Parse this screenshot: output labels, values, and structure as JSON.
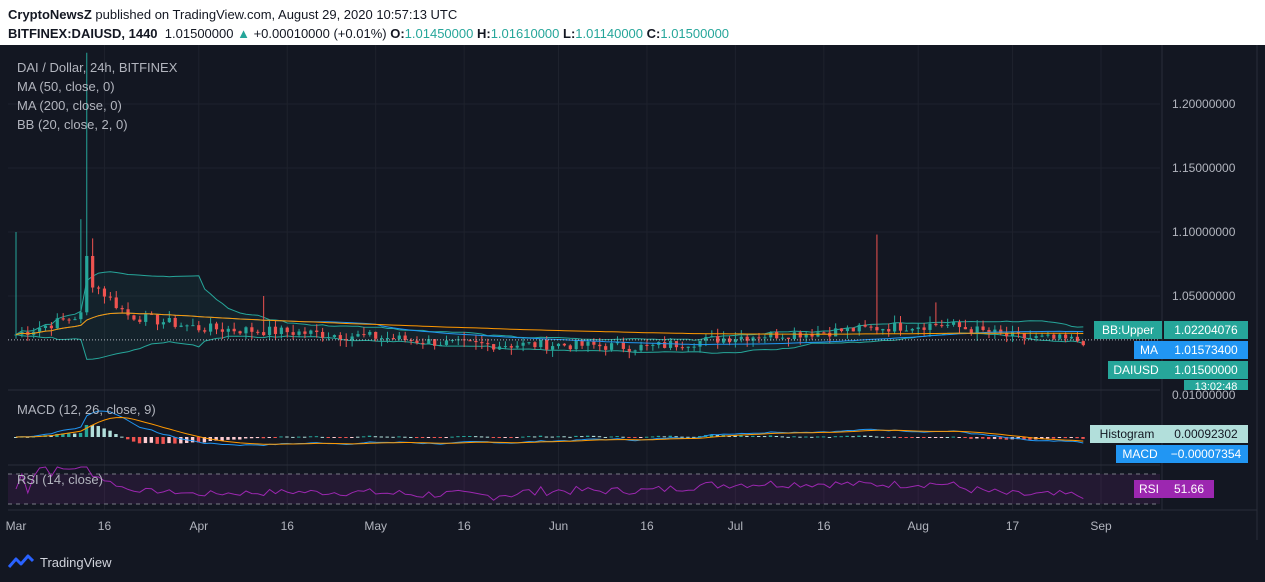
{
  "header": {
    "publisher": "CryptoNewsZ",
    "published_text": "published on TradingView.com, August 29, 2020 10:57:13 UTC",
    "symbol": "BITFINEX:DAIUSD, 1440",
    "last": "1.01500000",
    "change": "+0.00010000 (+0.01%)",
    "o_label": "O:",
    "o_value": "1.01450000",
    "h_label": "H:",
    "h_value": "1.01610000",
    "l_label": "L:",
    "l_value": "1.01140000",
    "c_label": "C:",
    "c_value": "1.01500000"
  },
  "legend": {
    "title": "DAI / Dollar, 24h, BITFINEX",
    "ma50": "MA (50, close, 0)",
    "ma200": "MA (200, close, 0)",
    "bb": "BB (20, close, 2, 0)",
    "macd": "MACD (12, 26, close, 9)",
    "rsi": "RSI (14, close)"
  },
  "price_axis": {
    "ticks": [
      "1.20000000",
      "1.15000000",
      "1.10000000",
      "1.05000000"
    ],
    "macd_tick": "0.01000000"
  },
  "price_labels": {
    "bb_upper_name": "BB:Upper",
    "bb_upper_value": "1.02204076",
    "ma_name": "MA",
    "ma_value": "1.01573400",
    "symbol_name": "DAIUSD",
    "symbol_value": "1.01500000",
    "countdown": "13:02:48",
    "histogram_name": "Histogram",
    "histogram_value": "0.00092302",
    "macd_name": "MACD",
    "macd_value": "−0.00007354",
    "rsi_name": "RSI",
    "rsi_value": "51.66"
  },
  "time_axis": {
    "labels": [
      "Mar",
      "16",
      "Apr",
      "16",
      "May",
      "16",
      "Jun",
      "16",
      "Jul",
      "16",
      "Aug",
      "17",
      "Sep"
    ]
  },
  "brand": {
    "name": "TradingView",
    "icon": "tradingview-logo-icon"
  },
  "colors": {
    "up": "#26a69a",
    "down": "#ef5350",
    "ma50": "#2196f3",
    "ma200": "#ff9800",
    "bb": "#26a69a",
    "macd": "#2196f3",
    "signal": "#ff9800",
    "rsi": "#9c27b0"
  },
  "chart_data": [
    {
      "type": "candlestick",
      "title": "DAI / Dollar, 24h, BITFINEX",
      "x_range": [
        "2020-03-01",
        "2020-08-29"
      ],
      "y_ticks": [
        1.05,
        1.1,
        1.15,
        1.2
      ],
      "series": [
        {
          "name": "DAIUSD",
          "last": 1.015,
          "open": 1.0145,
          "high": 1.0161,
          "low": 1.0114,
          "close": 1.015
        },
        {
          "name": "MA",
          "last": 1.015734
        },
        {
          "name": "BB:Upper",
          "last": 1.02204076
        }
      ],
      "closes_approx": [
        {
          "date": "2020-03-01",
          "close": 1.02
        },
        {
          "date": "2020-03-12",
          "close": 1.035
        },
        {
          "date": "2020-03-13",
          "close": 1.08
        },
        {
          "date": "2020-03-14",
          "close": 1.06
        },
        {
          "date": "2020-03-20",
          "close": 1.035
        },
        {
          "date": "2020-04-01",
          "close": 1.025
        },
        {
          "date": "2020-04-16",
          "close": 1.022
        },
        {
          "date": "2020-05-01",
          "close": 1.018
        },
        {
          "date": "2020-05-16",
          "close": 1.012
        },
        {
          "date": "2020-06-01",
          "close": 1.012
        },
        {
          "date": "2020-06-16",
          "close": 1.01
        },
        {
          "date": "2020-07-01",
          "close": 1.018
        },
        {
          "date": "2020-07-16",
          "close": 1.022
        },
        {
          "date": "2020-07-28",
          "close": 1.026
        },
        {
          "date": "2020-08-05",
          "close": 1.028
        },
        {
          "date": "2020-08-17",
          "close": 1.018
        },
        {
          "date": "2020-08-29",
          "close": 1.015
        }
      ]
    },
    {
      "type": "bar",
      "title": "MACD (12, 26, close, 9)",
      "series": [
        {
          "name": "Histogram",
          "last": 0.00092302
        },
        {
          "name": "MACD",
          "last": -7.354e-05
        }
      ]
    },
    {
      "type": "line",
      "title": "RSI (14, close)",
      "series": [
        {
          "name": "RSI",
          "last": 51.66
        }
      ]
    }
  ]
}
